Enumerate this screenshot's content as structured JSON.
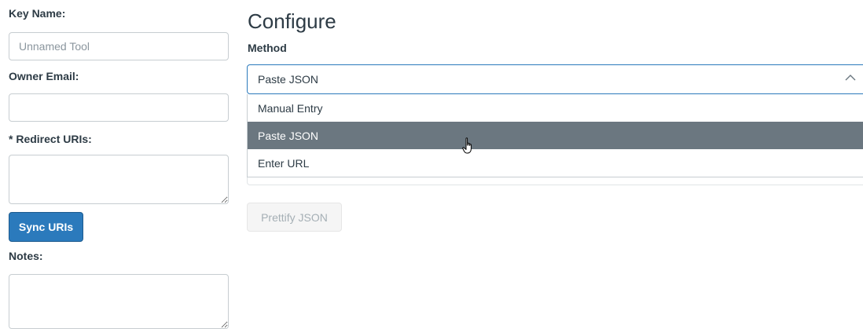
{
  "left_form": {
    "key_name_label": "Key Name:",
    "key_name_placeholder": "Unnamed Tool",
    "owner_email_label": "Owner Email:",
    "redirect_uris_label": "* Redirect URIs:",
    "sync_button": "Sync URIs",
    "notes_label": "Notes:"
  },
  "configure": {
    "heading": "Configure",
    "method_label": "Method",
    "selected_value": "Paste JSON",
    "options": [
      "Manual Entry",
      "Paste JSON",
      "Enter URL"
    ],
    "highlighted_option": "Paste JSON",
    "prettify_button": "Prettify JSON"
  },
  "colors": {
    "primary": "#2b7abc",
    "highlight": "#6b7780",
    "text": "#2d3b45"
  },
  "icons": {
    "select_toggle": "chevron-up-icon",
    "cursor": "hand-pointer-cursor"
  }
}
